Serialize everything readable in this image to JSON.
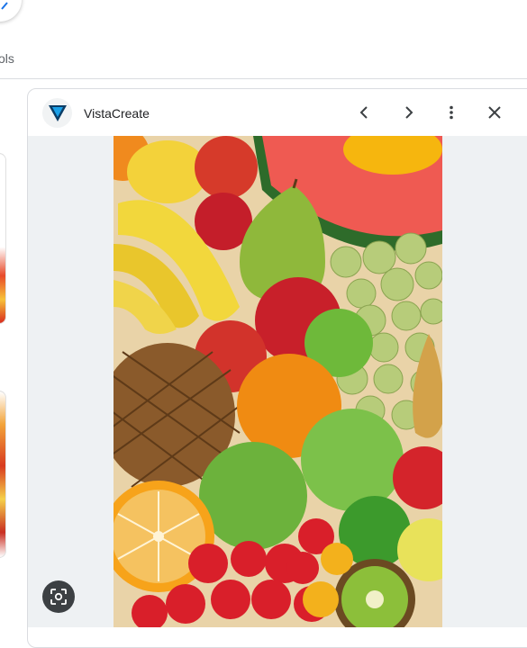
{
  "search": {
    "tools_label": "ols"
  },
  "panel": {
    "site_name": "VistaCreate",
    "buttons": {
      "prev": "chevron-left-icon",
      "next": "chevron-right-icon",
      "more": "more-vert-icon",
      "close": "close-icon"
    },
    "lens_button": "lens-icon"
  },
  "colors": {
    "brand": "#1a73e8",
    "logo_dark": "#0b3d66",
    "logo_blue": "#1aa0e8",
    "panel_bg": "#eef1f3",
    "text": "#202124",
    "muted": "#5f6368"
  }
}
